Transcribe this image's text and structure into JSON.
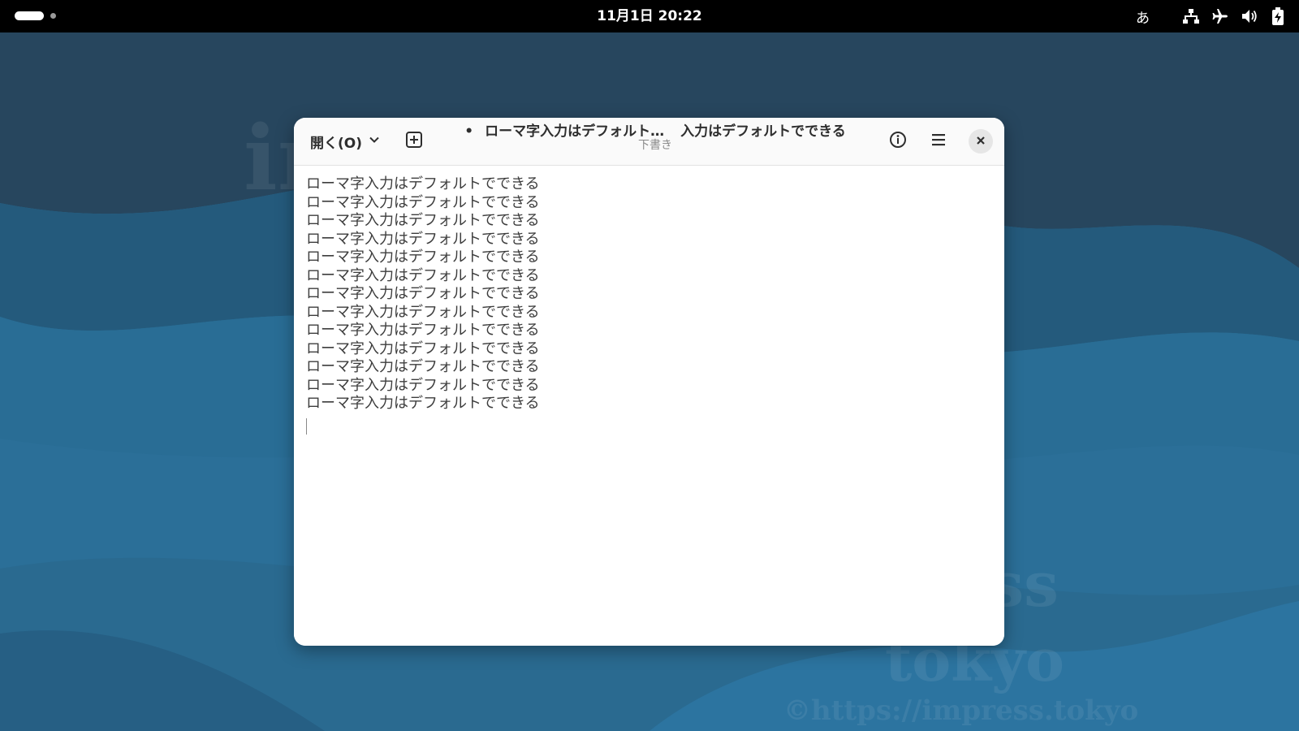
{
  "topbar": {
    "clock": "11月1日  20:22",
    "input_method": "あ"
  },
  "watermark": {
    "logo_left": "im",
    "logo_right": "ess",
    "city": "tokyo",
    "copyright": "©https://impress.tokyo"
  },
  "window": {
    "open_label": "開く(O)",
    "modified_marker": "•",
    "title_primary": "ローマ字入力はデフォルト…",
    "title_secondary": "入力はデフォルトでできる",
    "subtitle": "下書き",
    "lines": [
      "ローマ字入力はデフォルトでできる",
      "ローマ字入力はデフォルトでできる",
      "ローマ字入力はデフォルトでできる",
      "ローマ字入力はデフォルトでできる",
      "ローマ字入力はデフォルトでできる",
      "ローマ字入力はデフォルトでできる",
      "ローマ字入力はデフォルトでできる",
      "ローマ字入力はデフォルトでできる",
      "ローマ字入力はデフォルトでできる",
      "ローマ字入力はデフォルトでできる",
      "ローマ字入力はデフォルトでできる",
      "ローマ字入力はデフォルトでできる",
      "ローマ字入力はデフォルトでできる"
    ]
  },
  "icons": {
    "open_dropdown": "chevron-down-icon",
    "new_tab": "new-tab-icon",
    "info": "info-icon",
    "menu": "hamburger-menu-icon",
    "close": "close-icon",
    "network": "network-icon",
    "airplane": "airplane-mode-icon",
    "volume": "volume-icon",
    "battery": "battery-icon"
  }
}
